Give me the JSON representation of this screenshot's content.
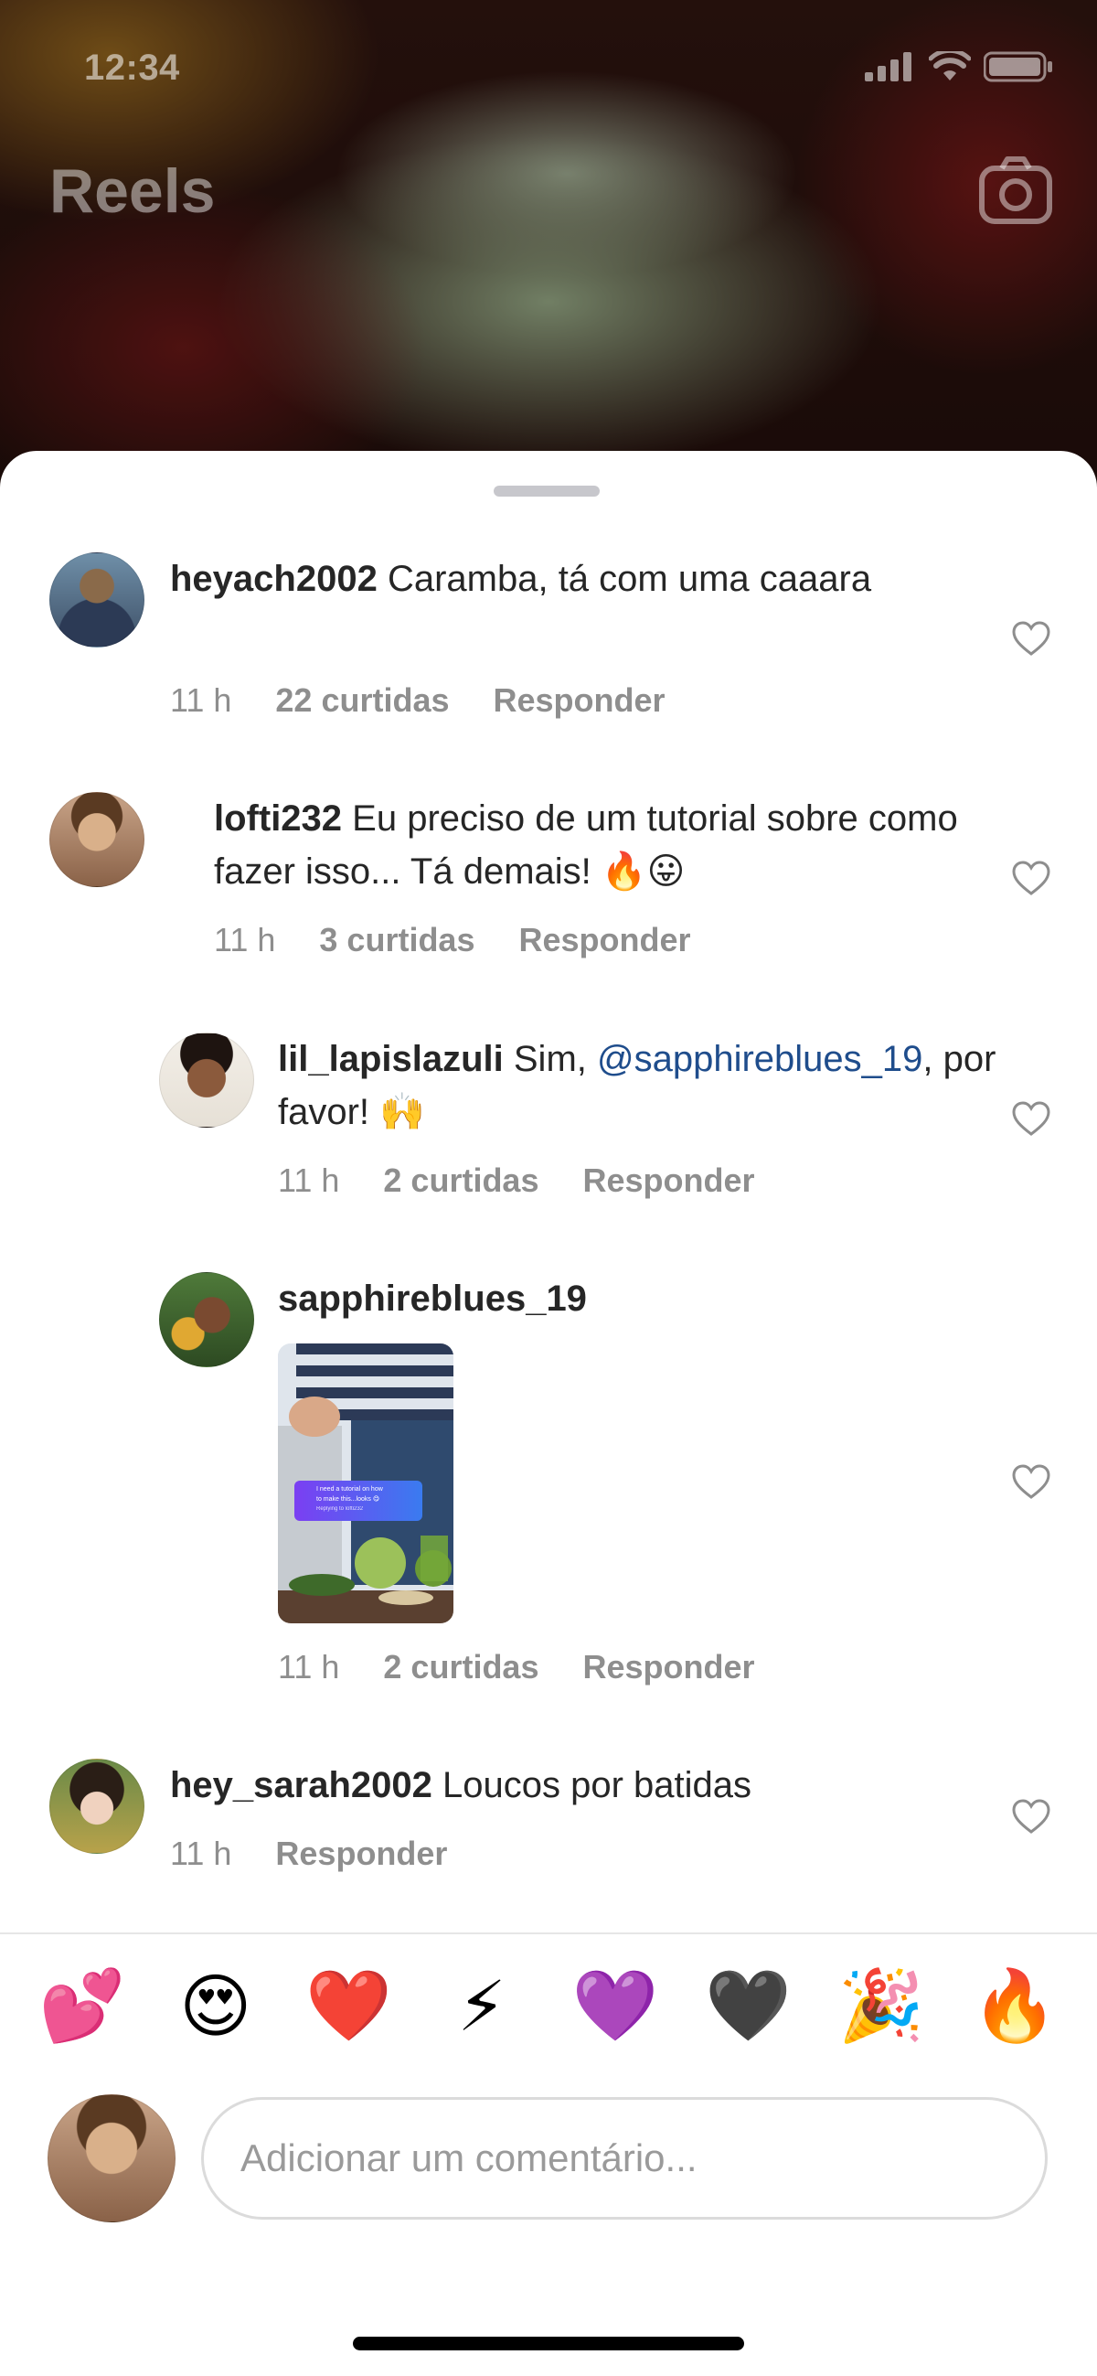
{
  "status_bar": {
    "time": "12:34"
  },
  "header": {
    "title": "Reels"
  },
  "comments": [
    {
      "username": "heyach2002",
      "text": " Caramba, tá com uma caaara",
      "time": "11 h",
      "likes": "22 curtidas",
      "reply": "Responder"
    },
    {
      "username": "lofti232",
      "text": " Eu preciso de um tutorial sobre como fazer isso... Tá demais! 🔥😛",
      "time": "11 h",
      "likes": "3 curtidas",
      "reply": "Responder"
    },
    {
      "username": "lil_lapislazuli",
      "text_before": " Sim, ",
      "mention": "@sapphireblues_19",
      "text_after": ", por favor! 🙌",
      "time": "11 h",
      "likes": "2 curtidas",
      "reply": "Responder"
    },
    {
      "username": "sapphireblues_19",
      "time": "11 h",
      "likes": "2 curtidas",
      "reply": "Responder"
    },
    {
      "username": "hey_sarah2002",
      "text": " Loucos por batidas",
      "time": "11 h",
      "reply": "Responder"
    }
  ],
  "thumbnail_sticker": {
    "line1": "I need a tutorial on how",
    "line2": "to make this...looks 😋",
    "line3": "Replying to lofti232"
  },
  "emoji_bar": [
    "💕",
    "😍",
    "❤️",
    "⚡",
    "💜",
    "🖤",
    "🎉",
    "🔥"
  ],
  "composer": {
    "placeholder": "Adicionar um comentário..."
  },
  "colors": {
    "mention": "#1f4d8c",
    "meta": "#8e8e8e",
    "text": "#262626"
  }
}
